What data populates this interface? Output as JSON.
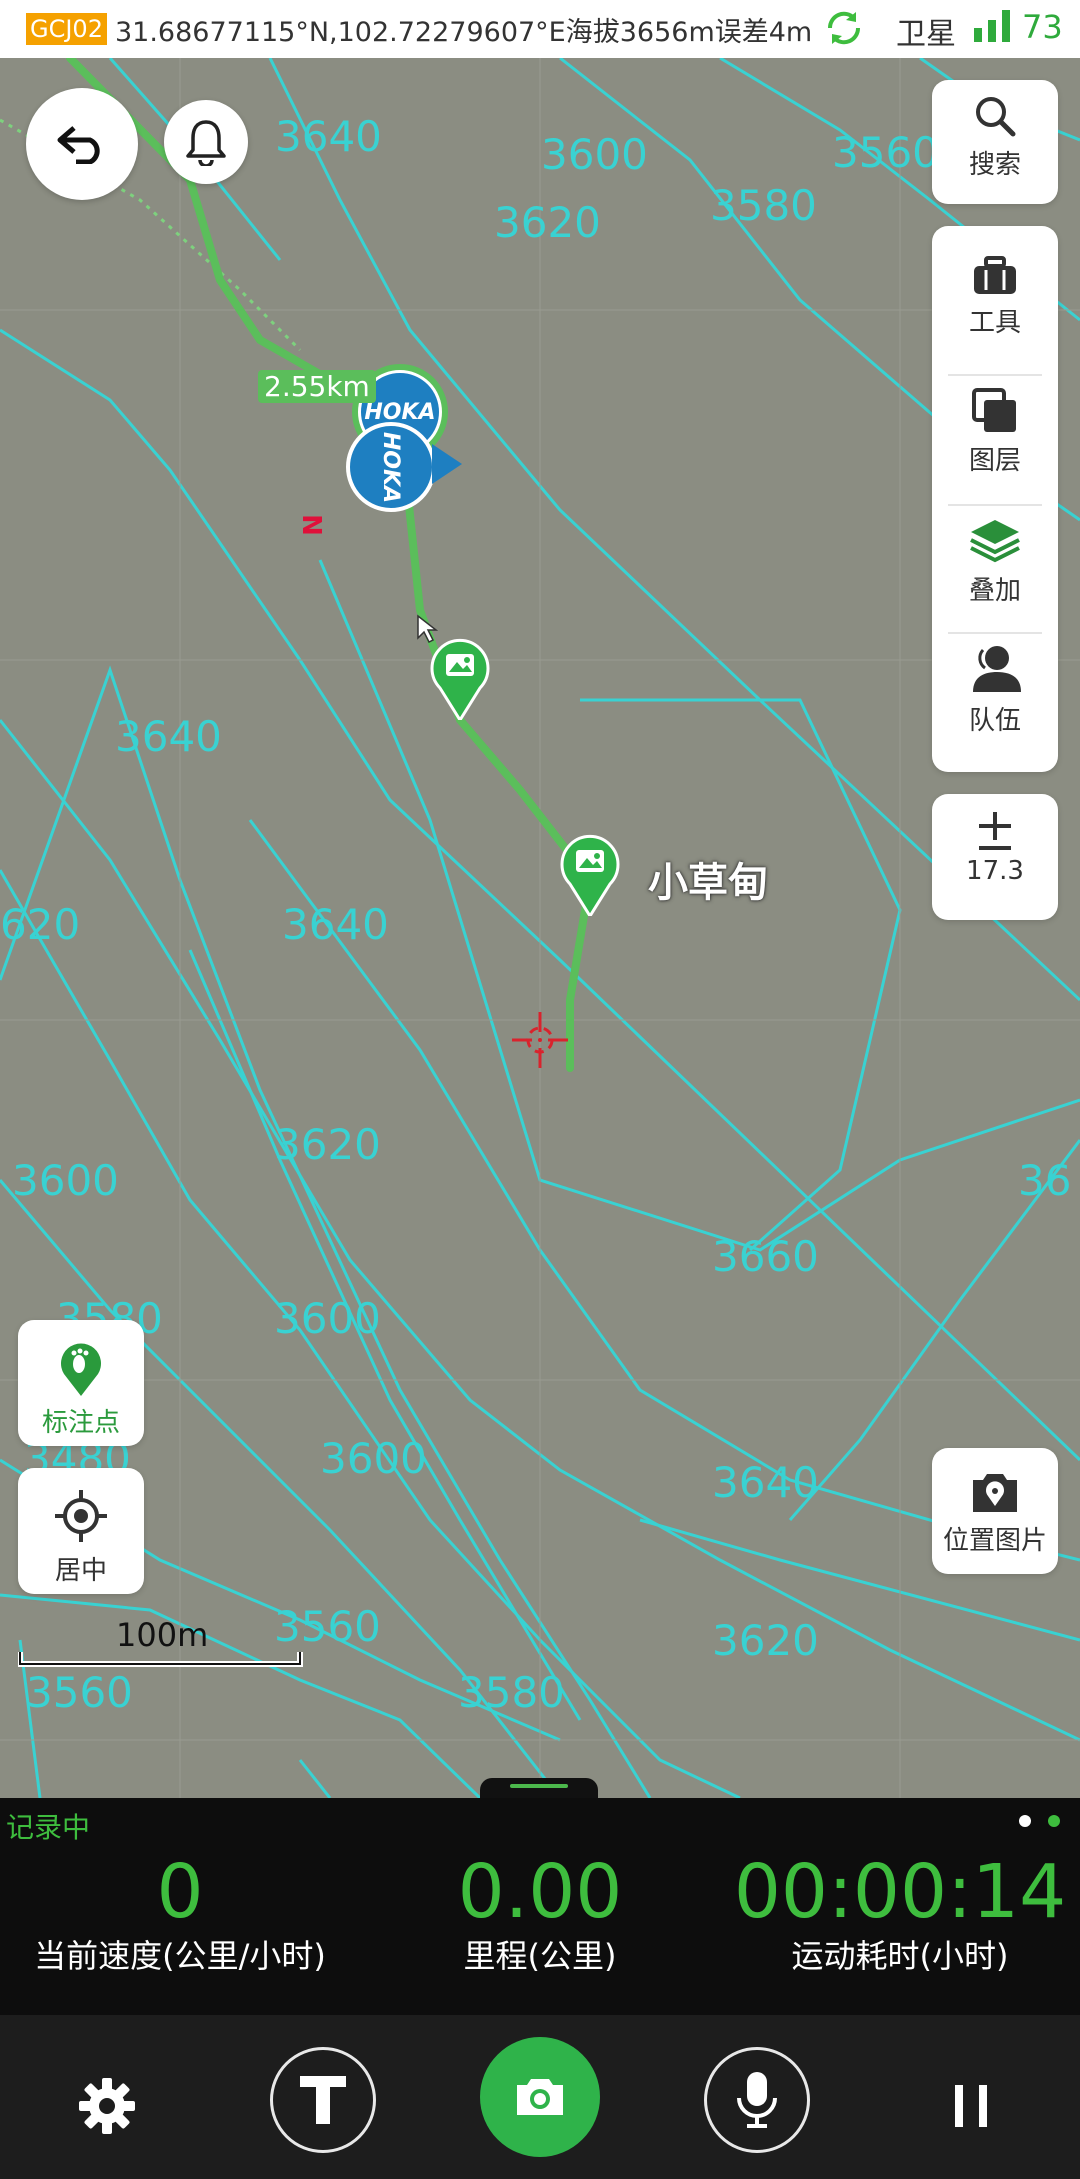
{
  "status": {
    "coord_system": "GCJ02",
    "coords": "31.68677115°N,102.72279607°E海拔3656m误差4m",
    "satellite_label": "卫星",
    "signal_value": "73"
  },
  "map": {
    "contour_labels": [
      "3640",
      "3600",
      "3560",
      "3620",
      "3580",
      "3640",
      "3640",
      "620",
      "3620",
      "3600",
      "36",
      "3660",
      "3580",
      "3600",
      "3600",
      "3640",
      "3480",
      "3560",
      "3620",
      "3560",
      "3580"
    ],
    "distance_badge": "2.55km",
    "poi_name": "小草甸",
    "scale_label": "100m",
    "north_marker": "N",
    "brand_marker": "HOKA"
  },
  "right_panel": {
    "search": "搜索",
    "tools": "工具",
    "layers": "图层",
    "overlay": "叠加",
    "team": "队伍",
    "zoom_level": "17.3"
  },
  "left_panel": {
    "mark_point": "标注点",
    "center": "居中"
  },
  "location_photo": "位置图片",
  "recording": {
    "label": "记录中",
    "speed_value": "0",
    "speed_label": "当前速度(公里/小时)",
    "distance_value": "0.00",
    "distance_label": "里程(公里)",
    "time_value": "00:00:14",
    "time_label": "运动耗时(小时)"
  },
  "colors": {
    "map_bg": "#8b8d82",
    "contour": "#39d2d2",
    "track": "#5bbe5b",
    "accent": "#3ebd3e",
    "gcj_badge": "#f5a100"
  }
}
